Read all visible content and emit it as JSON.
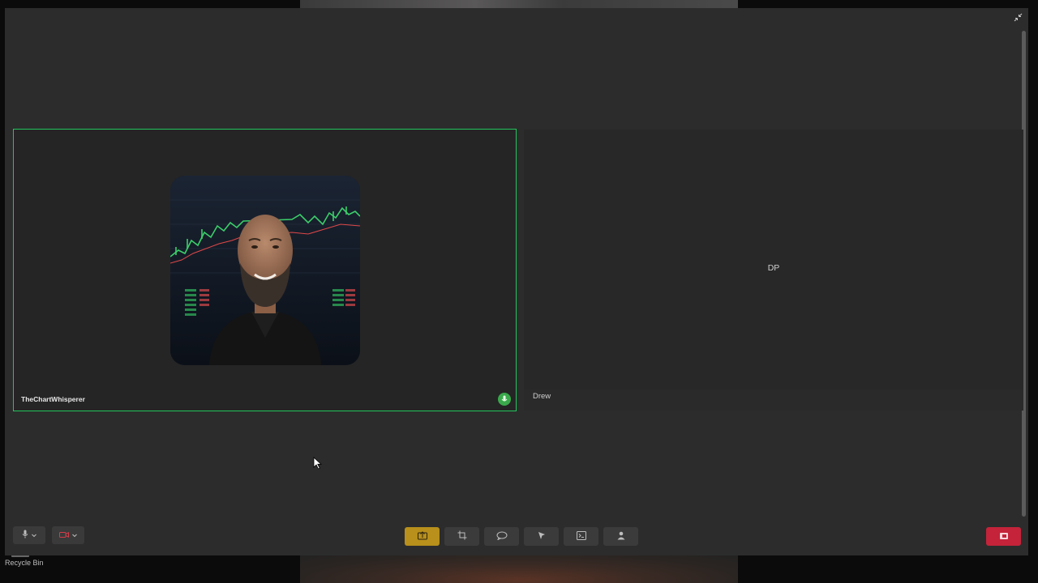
{
  "desktop": {
    "recycle_bin_label": "Recycle Bin"
  },
  "meeting": {
    "participants": [
      {
        "name": "TheChartWhisperer",
        "speaking": true,
        "mic_icon": "mic-icon"
      },
      {
        "name": "Drew",
        "initials": "DP"
      }
    ]
  },
  "toolbar": {
    "left": [
      {
        "icon": "mic-icon"
      },
      {
        "icon": "camera-off-icon"
      }
    ],
    "center": [
      {
        "icon": "share-screen-icon",
        "active": true
      },
      {
        "icon": "screenshot-icon"
      },
      {
        "icon": "chat-icon"
      },
      {
        "icon": "pointer-icon"
      },
      {
        "icon": "terminal-icon"
      },
      {
        "icon": "add-participant-icon"
      }
    ],
    "end": {
      "icon": "end-call-icon"
    }
  },
  "colors": {
    "active_border": "#22c55e",
    "share_button": "#b8901b",
    "end_button": "#c4233a",
    "speaking_badge": "#3aa94c"
  }
}
